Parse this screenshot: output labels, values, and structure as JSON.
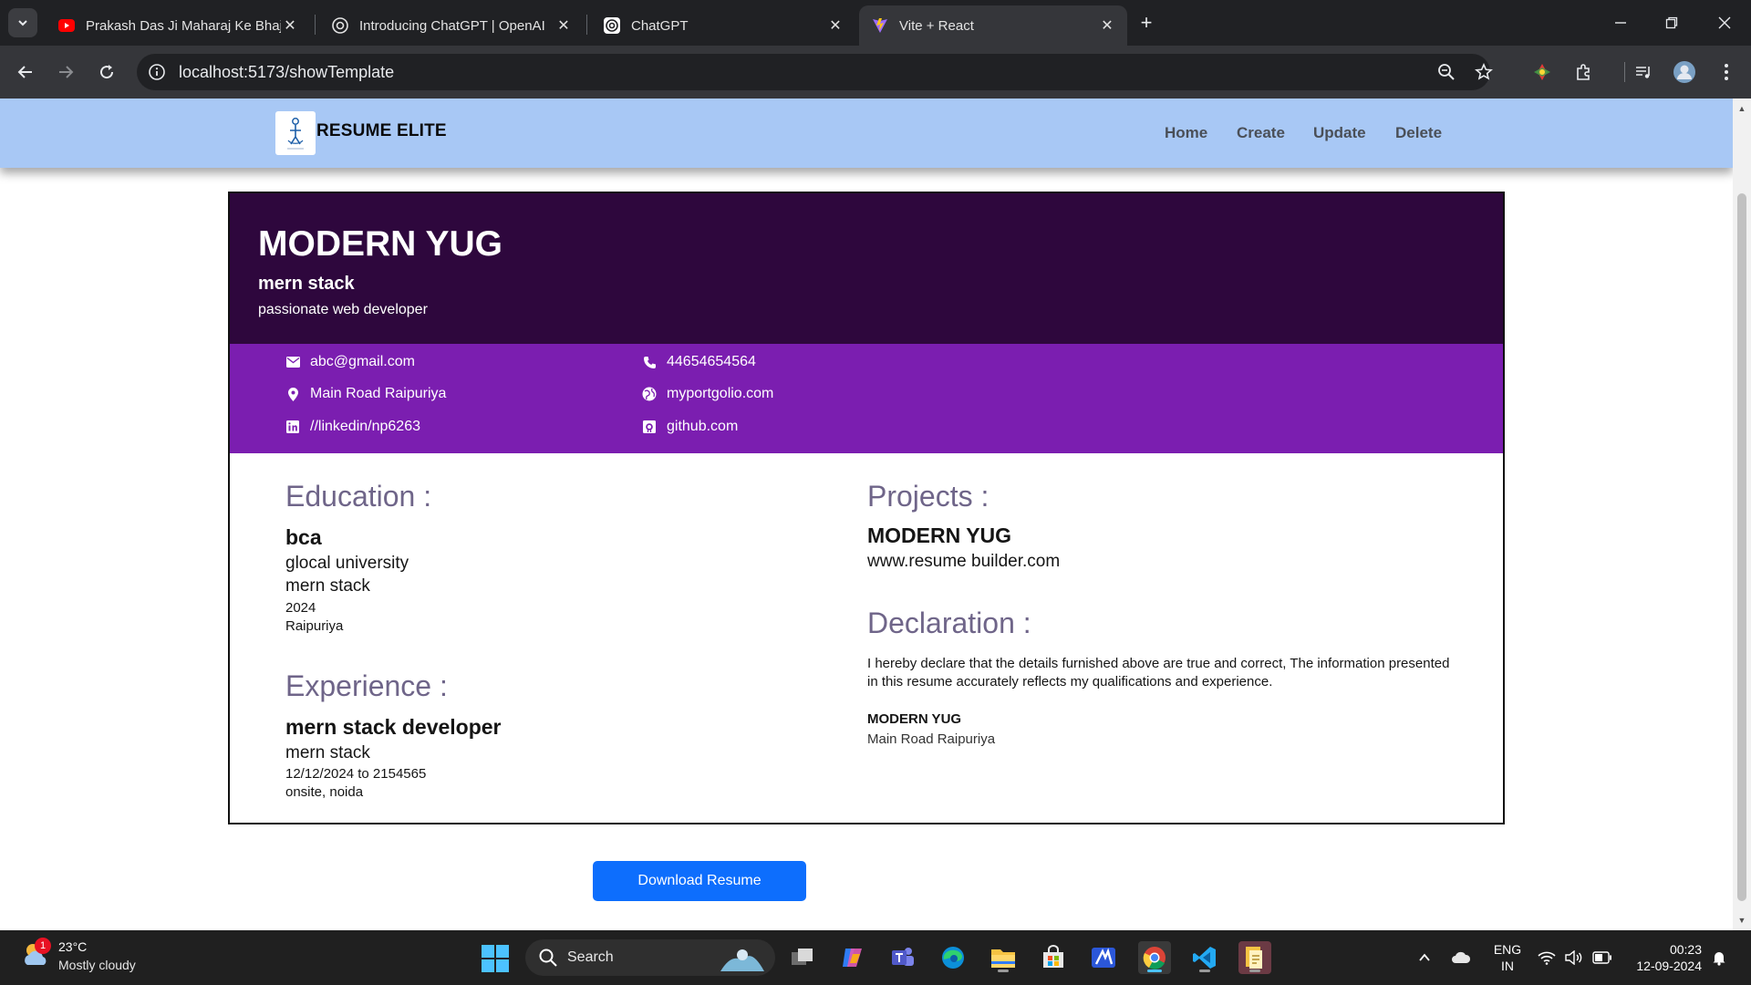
{
  "browser": {
    "tabs": [
      {
        "title": "Prakash Das Ji Maharaj Ke Bhajan",
        "favicon": "youtube-icon",
        "active": false
      },
      {
        "title": "Introducing ChatGPT | OpenAI",
        "favicon": "openai-icon",
        "active": false
      },
      {
        "title": "ChatGPT",
        "favicon": "openai-icon",
        "active": false
      },
      {
        "title": "Vite + React",
        "favicon": "vite-icon",
        "active": true
      }
    ],
    "url": "localhost:5173/showTemplate"
  },
  "site": {
    "brand": "RESUME ELITE",
    "nav": [
      "Home",
      "Create",
      "Update",
      "Delete"
    ]
  },
  "resume": {
    "name": "MODERN YUG",
    "title": "mern stack",
    "summary": "passionate web developer",
    "contacts": {
      "email": "abc@gmail.com",
      "phone": "44654654564",
      "address": "Main Road Raipuriya",
      "website": "myportgolio.com",
      "linkedin": "//linkedin/np6263",
      "github": "github.com"
    },
    "education": {
      "heading": "Education :",
      "degree": "bca",
      "institution": "glocal university",
      "field": "mern stack",
      "year": "2024",
      "location": "Raipuriya"
    },
    "experience": {
      "heading": "Experience :",
      "role": "mern stack developer",
      "field": "mern stack",
      "dates": "12/12/2024 to 2154565",
      "location": "onsite, noida"
    },
    "projects": {
      "heading": "Projects :",
      "name": "MODERN YUG",
      "link": "www.resume builder.com"
    },
    "declaration": {
      "heading": "Declaration :",
      "text": "I hereby declare that the details furnished above are true and correct, The information presented in this resume accurately reflects my qualifications and experience.",
      "signature_name": "MODERN YUG",
      "signature_place": "Main Road Raipuriya"
    },
    "download_label": "Download Resume"
  },
  "taskbar": {
    "weather_temp": "23°C",
    "weather_desc": "Mostly cloudy",
    "weather_badge": "1",
    "search_label": "Search",
    "lang_top": "ENG",
    "lang_bottom": "IN",
    "time": "00:23",
    "date": "12-09-2024"
  },
  "colors": {
    "nav_bg": "#a8c8f5",
    "header_bg": "#2e073d",
    "contacts_bg": "#7b1eb0",
    "section_title": "#6f6589",
    "button": "#0d6efd"
  }
}
